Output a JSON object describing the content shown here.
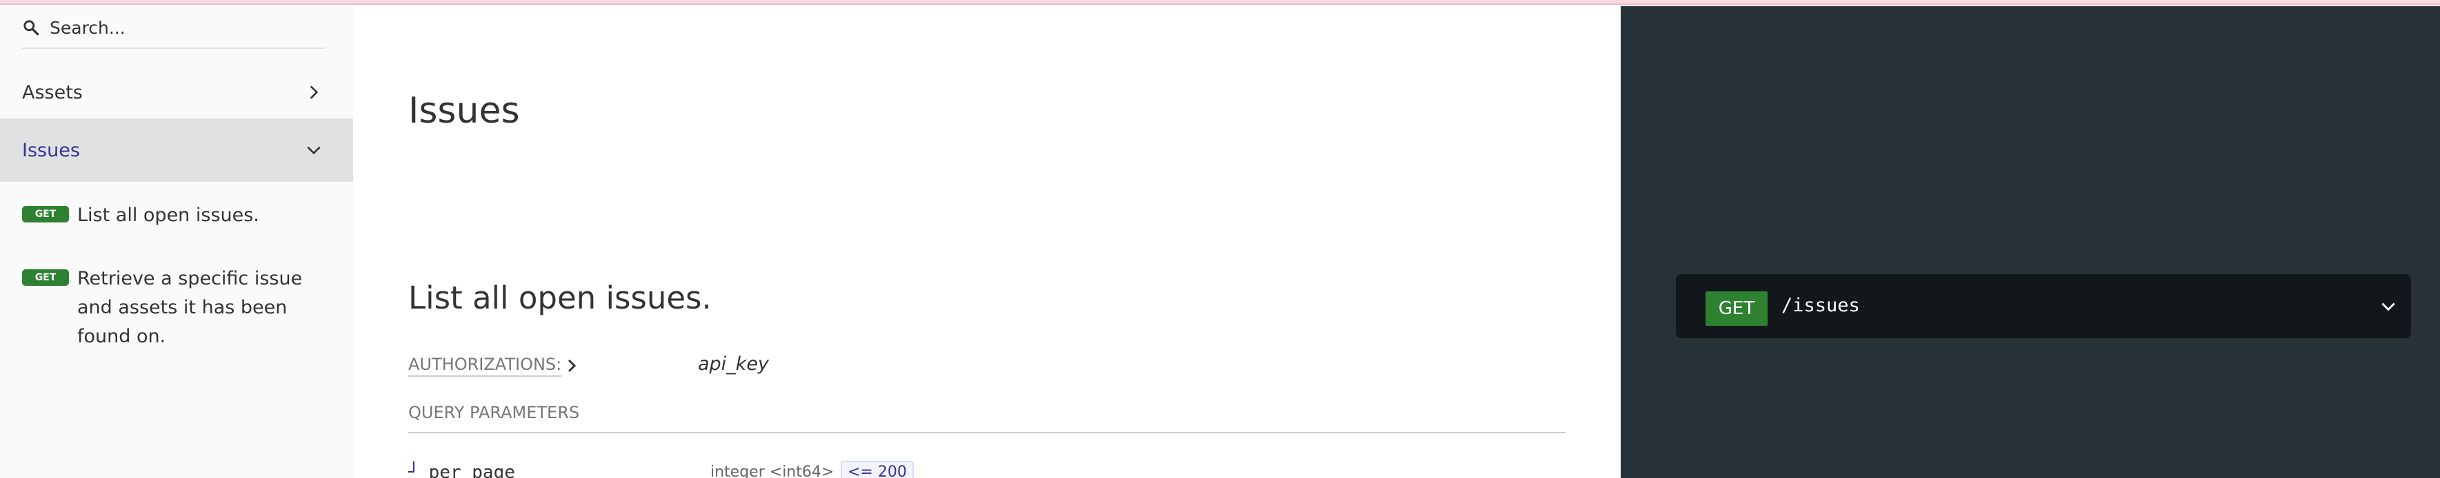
{
  "search": {
    "placeholder": "Search..."
  },
  "sidebar": {
    "items": [
      {
        "label": "Assets",
        "icon": "chevron-right-icon"
      },
      {
        "label": "Issues",
        "icon": "chevron-down-icon",
        "active": true
      }
    ],
    "operations": [
      {
        "method": "GET",
        "label": "List all open issues."
      },
      {
        "method": "GET",
        "label": "Retrieve a specific issue and assets it has been found on."
      }
    ]
  },
  "main": {
    "section_title": "Issues",
    "operation_title": "List all open issues.",
    "authorizations_label": "AUTHORIZATIONS:",
    "authorizations_value": "api_key",
    "query_params_label": "QUERY PARAMETERS",
    "params": [
      {
        "name": "per_page",
        "type": "integer <int64>",
        "constraint": "<= 200"
      }
    ]
  },
  "right_panel": {
    "method": "GET",
    "path": "/issues"
  },
  "colors": {
    "accent": "#32329f",
    "get_green": "#2f8132",
    "right_panel_bg": "#263238",
    "endpoint_bg": "#11171a"
  }
}
